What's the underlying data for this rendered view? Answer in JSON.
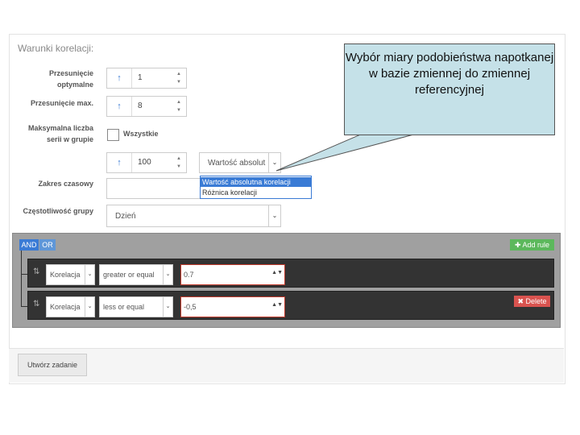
{
  "panel": {
    "title": "Warunki korelacji:"
  },
  "form": {
    "opt_shift": {
      "label_line1": "Przesunięcie",
      "label_line2": "optymalne",
      "value": "1"
    },
    "max_shift": {
      "label": "Przesunięcie max.",
      "value": "8"
    },
    "max_series": {
      "label_line1": "Maksymalna liczba",
      "label_line2": "serii w grupie",
      "checkbox_label": "Wszystkie"
    },
    "extra": {
      "value": "100",
      "select_value": "Wartość absolut"
    },
    "time_range": {
      "label": "Zakres czasowy"
    },
    "group_freq": {
      "label": "Częstotliwość grupy",
      "value": "Dzień"
    }
  },
  "dropdown": {
    "options": [
      "Wartość absolutna korelacji",
      "Różnica korelacji"
    ],
    "highlighted": 0
  },
  "query_builder": {
    "and_label": "AND",
    "or_label": "OR",
    "add_rule_label": "Add rule",
    "rules": [
      {
        "field": "Korelacja",
        "operator": "greater or equal",
        "value": "0.7"
      },
      {
        "field": "Korelacja",
        "operator": "less or equal",
        "value": "-0,5",
        "delete_label": "Delete"
      }
    ]
  },
  "footer": {
    "create_label": "Utwórz zadanie"
  },
  "callout": {
    "text": "Wybór miary podobieństwa napotkanej w bazie zmiennej do zmiennej referencyjnej"
  },
  "colors": {
    "primary": "#3a7bd5",
    "success": "#5cb85c",
    "danger": "#d9534f",
    "callout_bg": "#c5e1e8",
    "rule_bg": "#333333"
  }
}
